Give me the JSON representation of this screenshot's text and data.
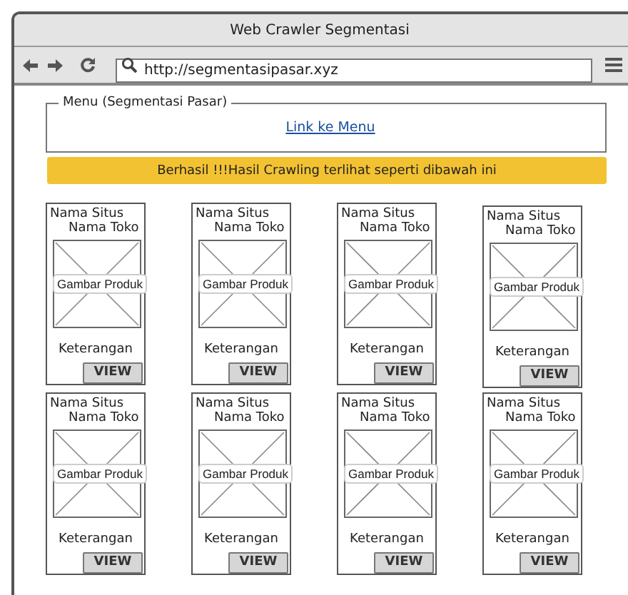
{
  "window": {
    "title": "Web Crawler Segmentasi"
  },
  "address_bar": {
    "value": "http://segmentasipasar.xyz"
  },
  "menu_group": {
    "legend": "Menu (Segmentasi Pasar)",
    "link": "Link ke Menu"
  },
  "alert": {
    "text": "Berhasil !!!Hasil Crawling terlihat seperti dibawah ini"
  },
  "cards": [
    {
      "site": "Nama Situs",
      "store": "Nama Toko",
      "image_label": "Gambar Produk",
      "description": "Keterangan",
      "button": "VIEW"
    },
    {
      "site": "Nama Situs",
      "store": "Nama Toko",
      "image_label": "Gambar Produk",
      "description": "Keterangan",
      "button": "VIEW"
    },
    {
      "site": "Nama Situs",
      "store": "Nama Toko",
      "image_label": "Gambar Produk",
      "description": "Keterangan",
      "button": "VIEW"
    },
    {
      "site": "Nama Situs",
      "store": "Nama Toko",
      "image_label": "Gambar Produk",
      "description": "Keterangan",
      "button": "VIEW"
    },
    {
      "site": "Nama Situs",
      "store": "Nama Toko",
      "image_label": "Gambar Produk",
      "description": "Keterangan",
      "button": "VIEW"
    },
    {
      "site": "Nama Situs",
      "store": "Nama Toko",
      "image_label": "Gambar Produk",
      "description": "Keterangan",
      "button": "VIEW"
    },
    {
      "site": "Nama Situs",
      "store": "Nama Toko",
      "image_label": "Gambar Produk",
      "description": "Keterangan",
      "button": "VIEW"
    },
    {
      "site": "Nama Situs",
      "store": "Nama Toko",
      "image_label": "Gambar Produk",
      "description": "Keterangan",
      "button": "VIEW"
    }
  ]
}
